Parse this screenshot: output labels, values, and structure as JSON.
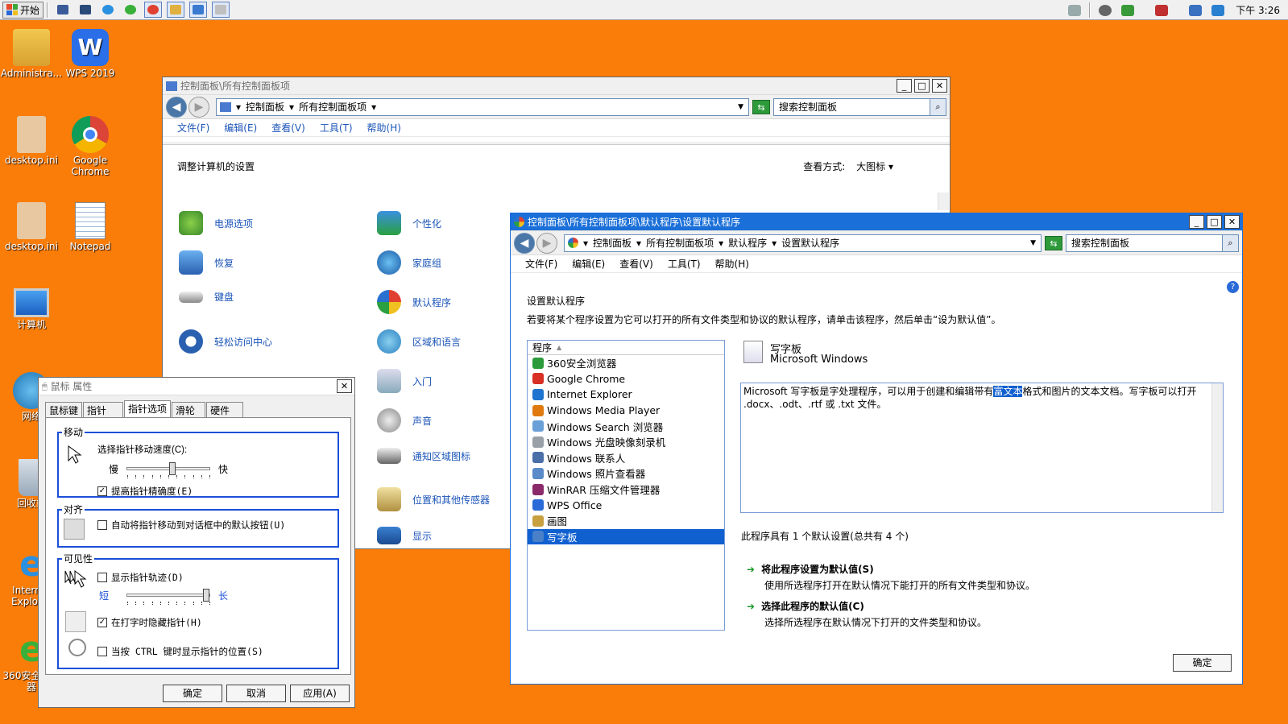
{
  "taskbar": {
    "start_label": "开始",
    "clock": "下午 3:26"
  },
  "desktop": {
    "icons": [
      {
        "label": "Administra...",
        "icon": "user-folder-icon"
      },
      {
        "label": "WPS 2019",
        "icon": "wps-icon"
      },
      {
        "label": "desktop.ini",
        "icon": "settings-file-icon"
      },
      {
        "label": "Google Chrome",
        "icon": "chrome-icon"
      },
      {
        "label": "desktop.ini",
        "icon": "settings-file-icon"
      },
      {
        "label": "Notepad",
        "icon": "notepad-icon"
      },
      {
        "label": "计算机",
        "icon": "computer-icon"
      },
      {
        "label": "网络",
        "icon": "network-icon"
      },
      {
        "label": "回收站",
        "icon": "recycle-bin-icon"
      },
      {
        "label": "Internet Explorer",
        "icon": "ie-icon"
      },
      {
        "label": "360安全浏览器",
        "icon": "browser-360-icon"
      }
    ]
  },
  "control_panel": {
    "title": "控制面板\\所有控制面板项",
    "address": {
      "crumbs": [
        "控制面板",
        "所有控制面板项"
      ],
      "search_placeholder": "搜索控制面板"
    },
    "menu": [
      "文件(F)",
      "编辑(E)",
      "查看(V)",
      "工具(T)",
      "帮助(H)"
    ],
    "heading": "调整计算机的设置",
    "view_label": "查看方式:",
    "view_value": "大图标",
    "items_col1": [
      "电源选项",
      "恢复",
      "键盘",
      "轻松访问中心"
    ],
    "items_col2": [
      "个性化",
      "家庭组",
      "默认程序",
      "区域和语言",
      "入门",
      "声音",
      "通知区域图标",
      "位置和其他传感器",
      "显示"
    ]
  },
  "default_programs": {
    "title": "控制面板\\所有控制面板项\\默认程序\\设置默认程序",
    "address": {
      "crumbs": [
        "控制面板",
        "所有控制面板项",
        "默认程序",
        "设置默认程序"
      ],
      "search_placeholder": "搜索控制面板"
    },
    "menu": [
      "文件(F)",
      "编辑(E)",
      "查看(V)",
      "工具(T)",
      "帮助(H)"
    ],
    "heading": "设置默认程序",
    "instruction": "若要将某个程序设置为它可以打开的所有文件类型和协议的默认程序，请单击该程序，然后单击“设为默认值”。",
    "list_header": "程序",
    "programs": [
      {
        "name": "360安全浏览器",
        "color": "#2a9a3a"
      },
      {
        "name": "Google Chrome",
        "color": "#d93025"
      },
      {
        "name": "Internet Explorer",
        "color": "#1f74d0"
      },
      {
        "name": "Windows Media Player",
        "color": "#e07a10"
      },
      {
        "name": "Windows Search 浏览器",
        "color": "#6aa0d8"
      },
      {
        "name": "Windows 光盘映像刻录机",
        "color": "#9aa0a8"
      },
      {
        "name": "Windows 联系人",
        "color": "#4a6ea8"
      },
      {
        "name": "Windows 照片查看器",
        "color": "#5a8ac8"
      },
      {
        "name": "WinRAR 压缩文件管理器",
        "color": "#8a2a6a"
      },
      {
        "name": "WPS Office",
        "color": "#2a6ad8"
      },
      {
        "name": "画图",
        "color": "#c8a040"
      },
      {
        "name": "写字板",
        "color": "#4a80c8"
      }
    ],
    "selected_index": 11,
    "selected_name": "写字板",
    "selected_publisher": "Microsoft Windows",
    "description_pre": "Microsoft 写字板是字处理程序，可以用于创建和编辑带有",
    "description_hl": "富文本",
    "description_post": "格式和图片的文本文档。写字板可以打开 .docx、.odt、.rtf 或 .txt 文件。",
    "defaults_summary": "此程序具有 1 个默认设置(总共有 4 个)",
    "action1_title": "将此程序设置为默认值(S)",
    "action1_desc": "使用所选程序打开在默认情况下能打开的所有文件类型和协议。",
    "action2_title": "选择此程序的默认值(C)",
    "action2_desc": "选择所选程序在默认情况下打开的文件类型和协议。",
    "ok_label": "确定"
  },
  "mouse_dialog": {
    "title": "鼠标 属性",
    "tabs": [
      "鼠标键",
      "指针",
      "指针选项",
      "滑轮",
      "硬件"
    ],
    "active_tab": 2,
    "motion": {
      "group": "移动",
      "speed_label": "选择指针移动速度(C):",
      "slow": "慢",
      "fast": "快",
      "speed_value": 0.55,
      "precision_label": "提高指针精确度(E)",
      "precision_checked": true
    },
    "snap": {
      "group": "对齐",
      "snap_label": "自动将指针移动到对话框中的默认按钮(U)",
      "snap_checked": false
    },
    "visibility": {
      "group": "可见性",
      "trails_label": "显示指针轨迹(D)",
      "trails_checked": false,
      "short": "短",
      "long": "长",
      "trails_value": 1.0,
      "hide_label": "在打字时隐藏指针(H)",
      "hide_checked": true,
      "ctrl_label": "当按 CTRL 键时显示指针的位置(S)",
      "ctrl_checked": false
    },
    "buttons": [
      "确定",
      "取消",
      "应用(A)"
    ]
  }
}
